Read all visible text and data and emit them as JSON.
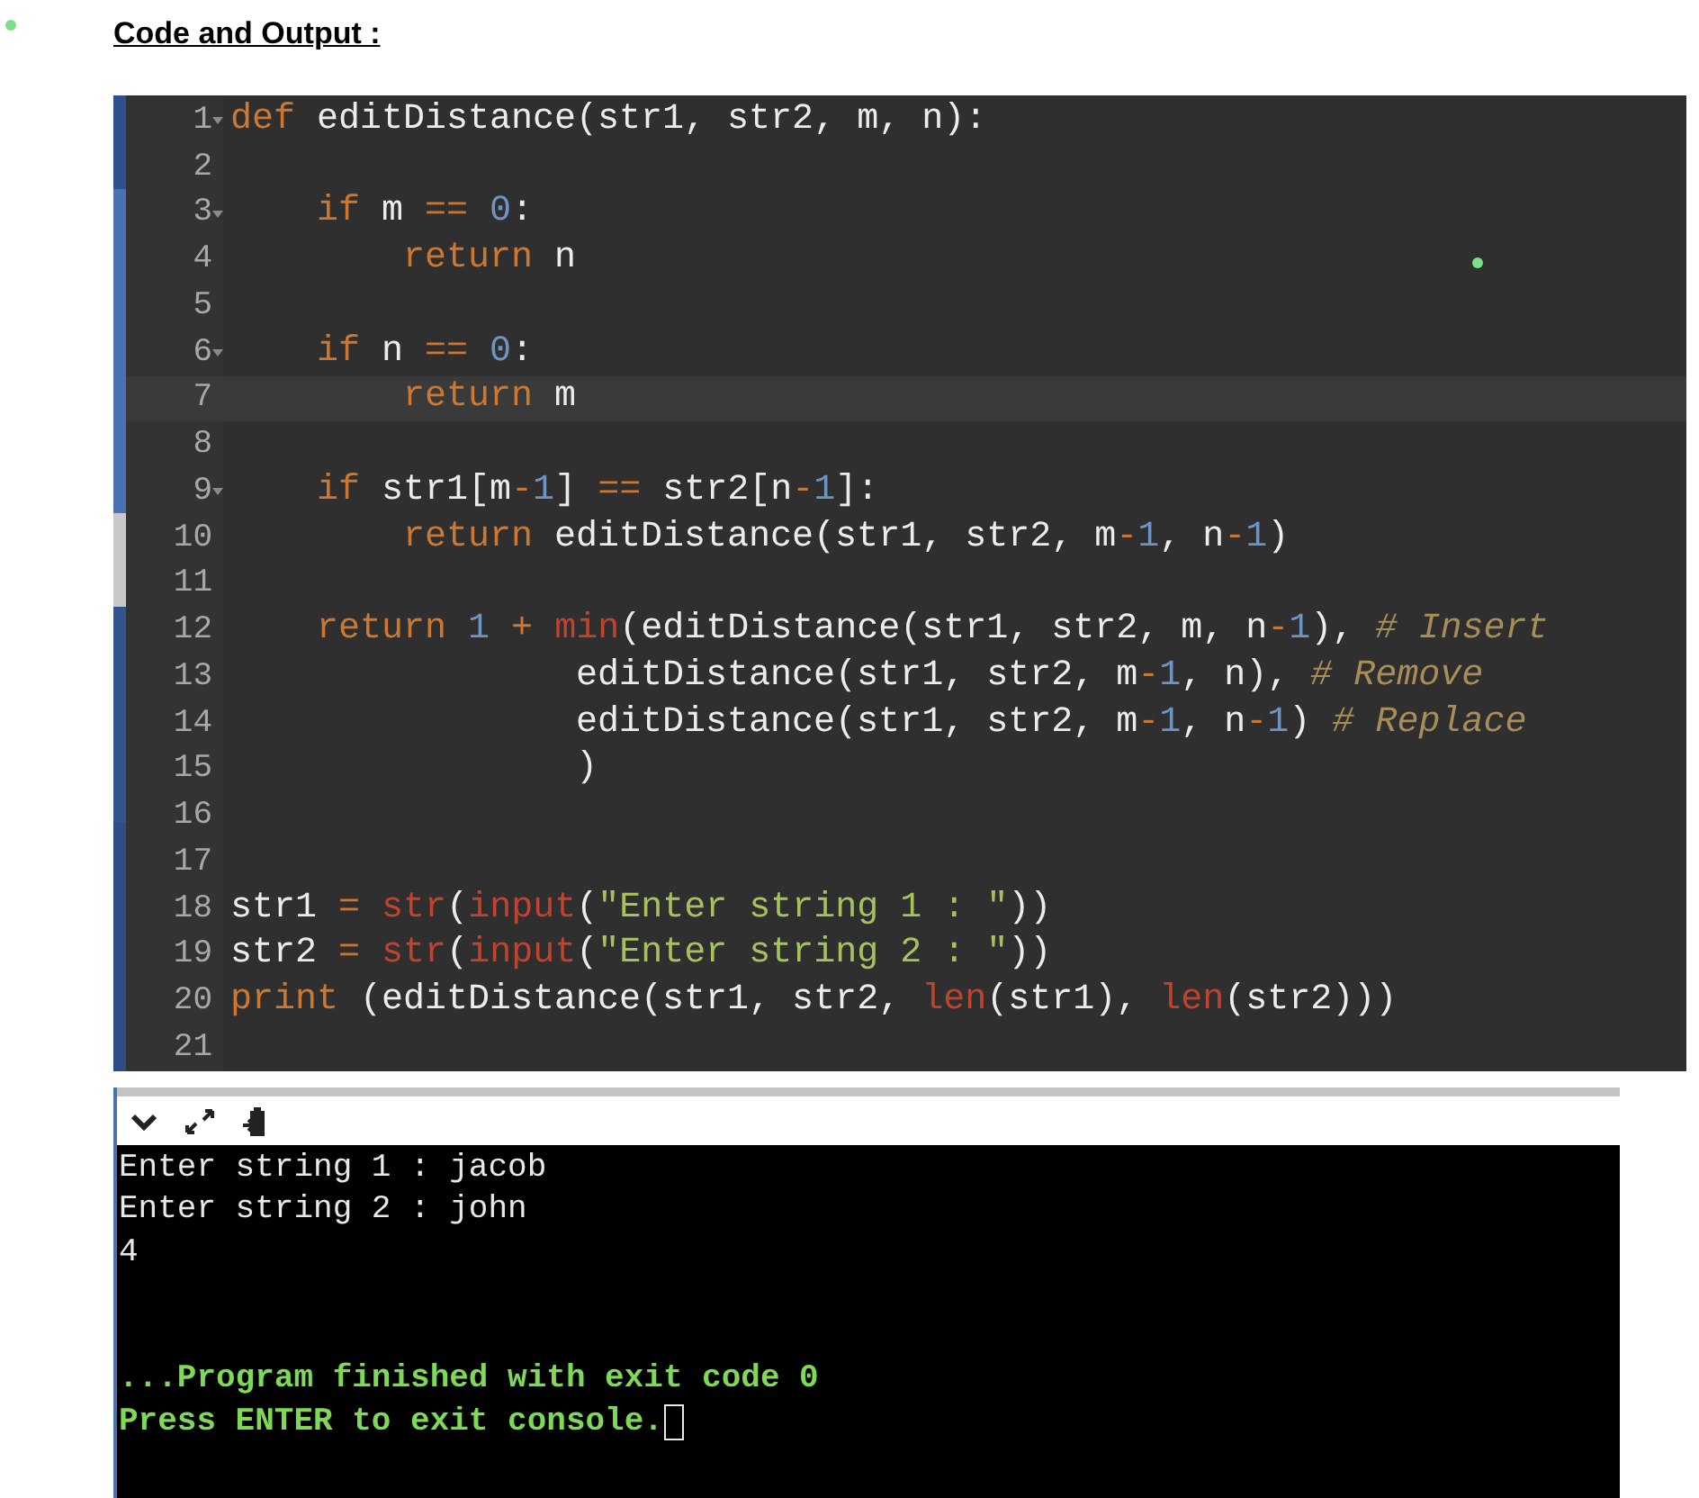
{
  "heading": "Code and Output :",
  "editor": {
    "lines": [
      {
        "number": "1",
        "fold": true,
        "active": false,
        "tokens": [
          {
            "kind": "keyword",
            "text": "def"
          },
          {
            "kind": "plain",
            "text": " editDistance(str1, str2, m, n):"
          }
        ]
      },
      {
        "number": "2",
        "fold": false,
        "active": false
      },
      {
        "number": "3",
        "fold": true,
        "active": false,
        "tokens": [
          {
            "kind": "keyword",
            "text": "    if"
          },
          {
            "kind": "plain",
            "text": " m "
          },
          {
            "kind": "operator",
            "text": "=="
          },
          {
            "kind": "number",
            "text": " 0"
          },
          {
            "kind": "plain",
            "text": ":"
          }
        ]
      },
      {
        "number": "4",
        "fold": false,
        "active": false,
        "tokens": [
          {
            "kind": "keyword",
            "text": "        return"
          },
          {
            "kind": "plain",
            "text": " n"
          }
        ]
      },
      {
        "number": "5",
        "fold": false,
        "active": false
      },
      {
        "number": "6",
        "fold": true,
        "active": false,
        "tokens": [
          {
            "kind": "keyword",
            "text": "    if"
          },
          {
            "kind": "plain",
            "text": " n "
          },
          {
            "kind": "operator",
            "text": "=="
          },
          {
            "kind": "number",
            "text": " 0"
          },
          {
            "kind": "plain",
            "text": ":"
          }
        ]
      },
      {
        "number": "7",
        "fold": false,
        "active": true,
        "tokens": [
          {
            "kind": "keyword",
            "text": "        return"
          },
          {
            "kind": "plain",
            "text": " m"
          }
        ]
      },
      {
        "number": "8",
        "fold": false,
        "active": false
      },
      {
        "number": "9",
        "fold": true,
        "active": false,
        "tokens": [
          {
            "kind": "keyword",
            "text": "    if"
          },
          {
            "kind": "plain",
            "text": " str1[m"
          },
          {
            "kind": "operator",
            "text": "-"
          },
          {
            "kind": "number",
            "text": "1"
          },
          {
            "kind": "plain",
            "text": "] "
          },
          {
            "kind": "operator",
            "text": "=="
          },
          {
            "kind": "plain",
            "text": " str2[n"
          },
          {
            "kind": "operator",
            "text": "-"
          },
          {
            "kind": "number",
            "text": "1"
          },
          {
            "kind": "plain",
            "text": "]:"
          }
        ]
      },
      {
        "number": "10",
        "fold": false,
        "active": false,
        "tokens": [
          {
            "kind": "keyword",
            "text": "        return"
          },
          {
            "kind": "plain",
            "text": " editDistance(str1, str2, m"
          },
          {
            "kind": "operator",
            "text": "-"
          },
          {
            "kind": "number",
            "text": "1"
          },
          {
            "kind": "plain",
            "text": ", n"
          },
          {
            "kind": "operator",
            "text": "-"
          },
          {
            "kind": "number",
            "text": "1"
          },
          {
            "kind": "plain",
            "text": ")"
          }
        ]
      },
      {
        "number": "11",
        "fold": false,
        "active": false
      },
      {
        "number": "12",
        "fold": false,
        "active": false,
        "tokens": [
          {
            "kind": "keyword",
            "text": "    return"
          },
          {
            "kind": "number",
            "text": " 1"
          },
          {
            "kind": "operator",
            "text": " +"
          },
          {
            "kind": "builtin",
            "text": " min"
          },
          {
            "kind": "plain",
            "text": "(editDistance(str1, str2, m, n"
          },
          {
            "kind": "operator",
            "text": "-"
          },
          {
            "kind": "number",
            "text": "1"
          },
          {
            "kind": "plain",
            "text": "),"
          },
          {
            "kind": "comment",
            "text": " # Insert"
          }
        ]
      },
      {
        "number": "13",
        "fold": false,
        "active": false,
        "tokens": [
          {
            "kind": "plain",
            "text": "                editDistance(str1, str2, m"
          },
          {
            "kind": "operator",
            "text": "-"
          },
          {
            "kind": "number",
            "text": "1"
          },
          {
            "kind": "plain",
            "text": ", n),"
          },
          {
            "kind": "comment",
            "text": " # Remove"
          }
        ]
      },
      {
        "number": "14",
        "fold": false,
        "active": false,
        "tokens": [
          {
            "kind": "plain",
            "text": "                editDistance(str1, str2, m"
          },
          {
            "kind": "operator",
            "text": "-"
          },
          {
            "kind": "number",
            "text": "1"
          },
          {
            "kind": "plain",
            "text": ", n"
          },
          {
            "kind": "operator",
            "text": "-"
          },
          {
            "kind": "number",
            "text": "1"
          },
          {
            "kind": "plain",
            "text": ")"
          },
          {
            "kind": "comment",
            "text": " # Replace"
          }
        ]
      },
      {
        "number": "15",
        "fold": false,
        "active": false,
        "tokens": [
          {
            "kind": "plain",
            "text": "                )"
          }
        ]
      },
      {
        "number": "16",
        "fold": false,
        "active": false
      },
      {
        "number": "17",
        "fold": false,
        "active": false
      },
      {
        "number": "18",
        "fold": false,
        "active": false,
        "tokens": [
          {
            "kind": "plain",
            "text": "str1"
          },
          {
            "kind": "operator",
            "text": " ="
          },
          {
            "kind": "builtin",
            "text": " str"
          },
          {
            "kind": "plain",
            "text": "("
          },
          {
            "kind": "builtin",
            "text": "input"
          },
          {
            "kind": "plain",
            "text": "("
          },
          {
            "kind": "string",
            "text": "\"Enter string 1 : \""
          },
          {
            "kind": "plain",
            "text": "))"
          }
        ]
      },
      {
        "number": "19",
        "fold": false,
        "active": false,
        "tokens": [
          {
            "kind": "plain",
            "text": "str2"
          },
          {
            "kind": "operator",
            "text": " ="
          },
          {
            "kind": "builtin",
            "text": " str"
          },
          {
            "kind": "plain",
            "text": "("
          },
          {
            "kind": "builtin",
            "text": "input"
          },
          {
            "kind": "plain",
            "text": "("
          },
          {
            "kind": "string",
            "text": "\"Enter string 2 : \""
          },
          {
            "kind": "plain",
            "text": "))"
          }
        ]
      },
      {
        "number": "20",
        "fold": false,
        "active": false,
        "tokens": [
          {
            "kind": "keyword",
            "text": "print"
          },
          {
            "kind": "plain",
            "text": " (editDistance(str1, str2,"
          },
          {
            "kind": "builtin",
            "text": " len"
          },
          {
            "kind": "plain",
            "text": "(str1),"
          },
          {
            "kind": "builtin",
            "text": " len"
          },
          {
            "kind": "plain",
            "text": "(str2)))"
          }
        ]
      },
      {
        "number": "21",
        "fold": false,
        "active": false
      }
    ]
  },
  "console": {
    "lines": [
      {
        "kind": "output",
        "text": "Enter string 1 : jacob"
      },
      {
        "kind": "output",
        "text": "Enter string 2 : john"
      },
      {
        "kind": "output",
        "text": "4"
      },
      {
        "kind": "status",
        "text": "...Program finished with exit code 0"
      },
      {
        "kind": "status",
        "text": "Press ENTER to exit console.",
        "cursor": true
      }
    ]
  }
}
